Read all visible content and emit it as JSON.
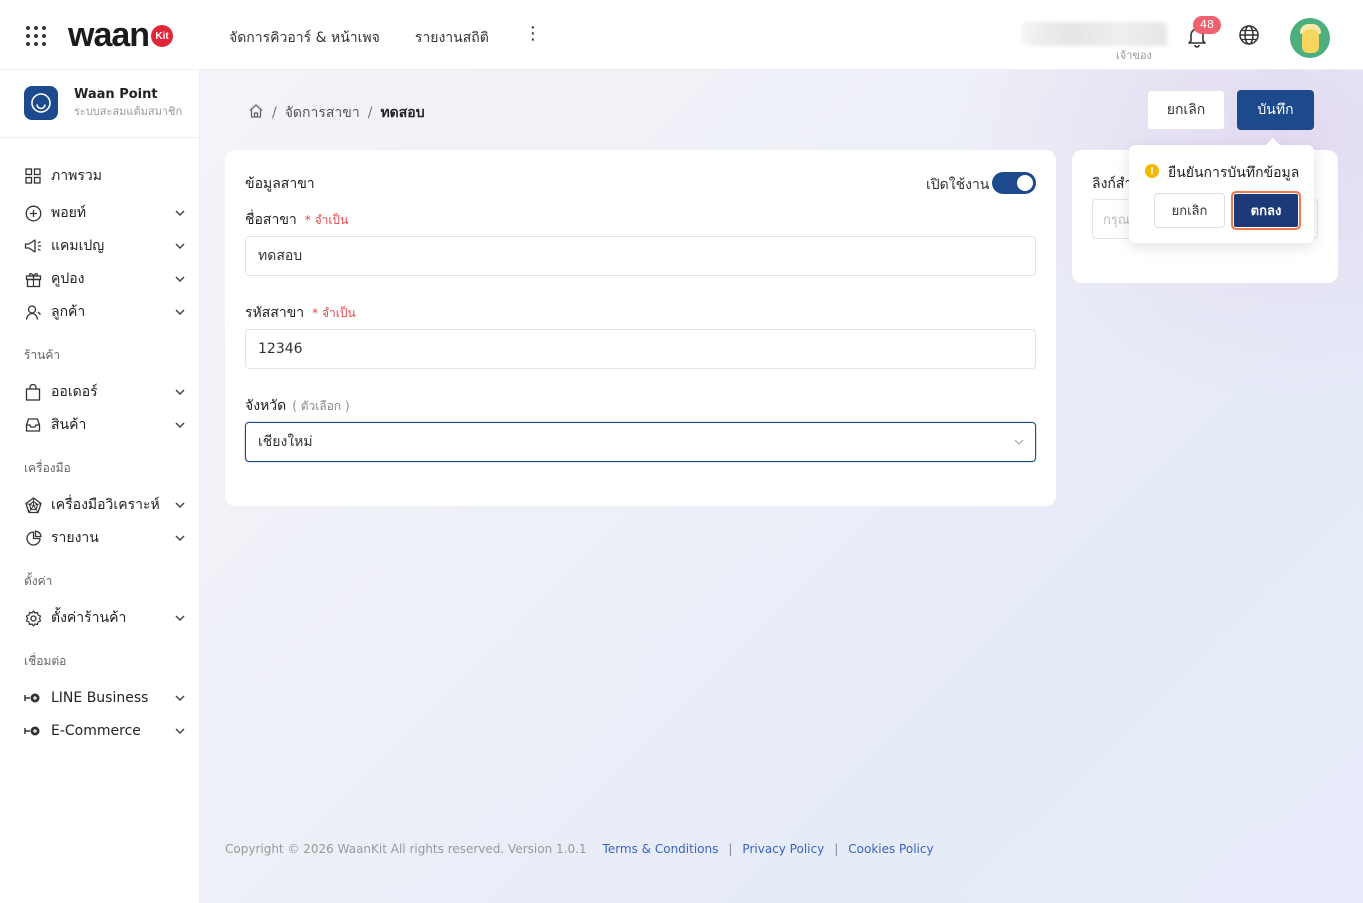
{
  "header": {
    "logo_text": "waan",
    "logo_badge": "Kit",
    "nav": [
      "จัดการคิวอาร์ & หน้าเพจ",
      "รายงานสถิติ"
    ],
    "more": "⋮",
    "user_role": "เจ้าของ",
    "notification_count": "48"
  },
  "sidebar": {
    "brand_title": "Waan Point",
    "brand_subtitle": "ระบบสะสมแต้มสมาชิก",
    "items": {
      "overview": "ภาพรวม",
      "point": "พอยท์",
      "campaign": "แคมเปญ",
      "coupon": "คูปอง",
      "customer": "ลูกค้า",
      "order": "ออเดอร์",
      "product": "สินค้า",
      "analytics": "เครื่องมือวิเคราะห์",
      "report": "รายงาน",
      "shop_settings": "ตั้งค่าร้านค้า",
      "line_business": "LINE Business",
      "ecommerce": "E-Commerce"
    },
    "sections": {
      "shop": "ร้านค้า",
      "tools": "เครื่องมือ",
      "settings": "ตั้งค่า",
      "connect": "เชื่อมต่อ"
    }
  },
  "breadcrumb": {
    "branch": "จัดการสาขา",
    "current": "ทดสอบ",
    "sep": "/"
  },
  "actions": {
    "cancel": "ยกเลิก",
    "save": "บันทึก"
  },
  "branch_form": {
    "title": "ข้อมูลสาขา",
    "toggle_label": "เปิดใช้งาน",
    "toggle_on": true,
    "name_label": "ชื่อสาขา",
    "name_required": "* จำเป็น",
    "name_value": "ทดสอบ",
    "code_label": "รหัสสาขา",
    "code_required": "* จำเป็น",
    "code_value": "12346",
    "province_label": "จังหวัด",
    "province_optional": "( ตัวเลือก )",
    "province_value": "เชียงใหม่"
  },
  "link_card": {
    "title": "ลิงก์สำ",
    "placeholder": "กรุณ"
  },
  "popconfirm": {
    "message": "ยืนยันการบันทึกข้อมูล",
    "cancel": "ยกเลิก",
    "ok": "ตกลง"
  },
  "footer": {
    "copyright": "Copyright © 2026 WaanKit All rights reserved. Version 1.0.1",
    "terms": "Terms & Conditions",
    "privacy": "Privacy Policy",
    "cookies": "Cookies Policy",
    "sep": "|"
  },
  "colors": {
    "primary": "#1d4a8c",
    "danger": "#e5484d",
    "badge": "#f0616e",
    "warning": "#f5b700",
    "focus_ring": "#ee7a4b"
  }
}
